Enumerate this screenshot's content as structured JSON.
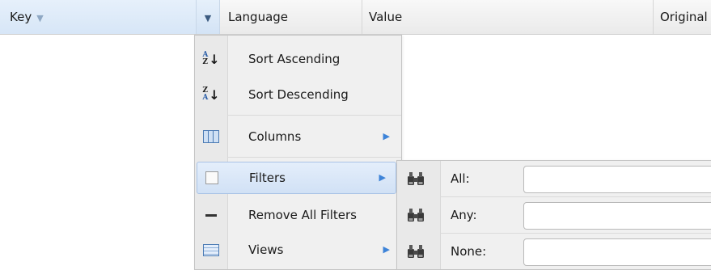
{
  "header": {
    "columns": {
      "key": "Key",
      "language": "Language",
      "value": "Value",
      "original": "Original"
    }
  },
  "menu": {
    "sort_ascending": "Sort Ascending",
    "sort_descending": "Sort Descending",
    "columns": "Columns",
    "filters": "Filters",
    "remove_all_filters": "Remove All Filters",
    "views": "Views"
  },
  "filters_submenu": {
    "all_label": "All:",
    "any_label": "Any:",
    "none_label": "None:",
    "all_value": "",
    "any_value": "",
    "none_value": ""
  },
  "colors": {
    "accent": "#3d83d8",
    "header_active": "#d7e6f7",
    "menu_bg": "#f0f0f0"
  }
}
